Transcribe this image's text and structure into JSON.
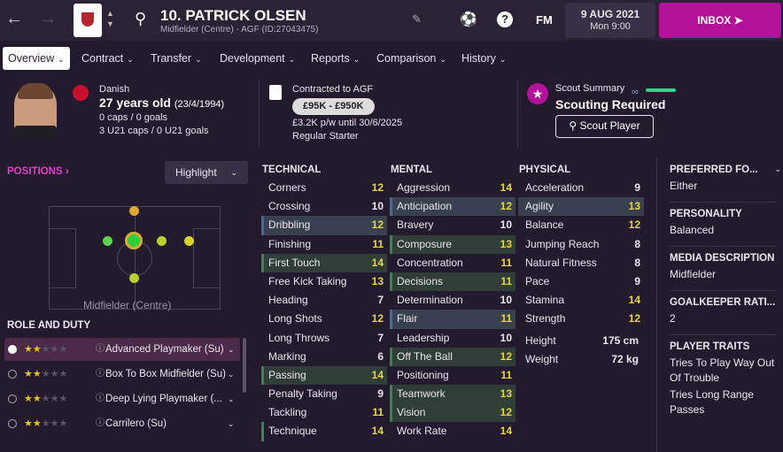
{
  "topbar": {
    "player_title": "10. PATRICK OLSEN",
    "player_sub": "Midfielder (Centre) - AGF (ID:27043475)",
    "date": "9 AUG 2021",
    "time": "Mon 9:00",
    "fm": "FM",
    "inbox": "INBOX"
  },
  "tabs": [
    {
      "label": "Overview"
    },
    {
      "label": "Contract"
    },
    {
      "label": "Transfer"
    },
    {
      "label": "Development"
    },
    {
      "label": "Reports"
    },
    {
      "label": "Comparison"
    },
    {
      "label": "History"
    }
  ],
  "profile": {
    "nationality": "Danish",
    "age": "27 years old",
    "dob": "(23/4/1994)",
    "caps": "0 caps / 0 goals",
    "u21": "3 U21 caps / 0 U21 goals"
  },
  "contract": {
    "club_label": "Contracted to AGF",
    "value": "£95K - £950K",
    "wage": "£3.2K p/w until 30/6/2025",
    "status": "Regular Starter"
  },
  "scout": {
    "label": "Scout Summary",
    "status": "Scouting Required",
    "button": "Scout Player"
  },
  "positions": {
    "title": "POSITIONS",
    "highlight": "Highlight",
    "label": "Midfielder (Centre)"
  },
  "roles": {
    "title": "ROLE AND DUTY",
    "items": [
      {
        "name": "Advanced Playmaker (Su)",
        "stars": 2
      },
      {
        "name": "Box To Box Midfielder (Su)",
        "stars": 2
      },
      {
        "name": "Deep Lying Playmaker (...",
        "stars": 2
      },
      {
        "name": "Carrilero (Su)",
        "stars": 2
      }
    ]
  },
  "technical": {
    "title": "TECHNICAL",
    "items": [
      {
        "name": "Corners",
        "value": "12"
      },
      {
        "name": "Crossing",
        "value": "10"
      },
      {
        "name": "Dribbling",
        "value": "12"
      },
      {
        "name": "Finishing",
        "value": "11"
      },
      {
        "name": "First Touch",
        "value": "14"
      },
      {
        "name": "Free Kick Taking",
        "value": "13"
      },
      {
        "name": "Heading",
        "value": "7"
      },
      {
        "name": "Long Shots",
        "value": "12"
      },
      {
        "name": "Long Throws",
        "value": "7"
      },
      {
        "name": "Marking",
        "value": "6"
      },
      {
        "name": "Passing",
        "value": "14"
      },
      {
        "name": "Penalty Taking",
        "value": "9"
      },
      {
        "name": "Tackling",
        "value": "11"
      },
      {
        "name": "Technique",
        "value": "14"
      }
    ]
  },
  "mental": {
    "title": "MENTAL",
    "items": [
      {
        "name": "Aggression",
        "value": "14"
      },
      {
        "name": "Anticipation",
        "value": "12"
      },
      {
        "name": "Bravery",
        "value": "10"
      },
      {
        "name": "Composure",
        "value": "13"
      },
      {
        "name": "Concentration",
        "value": "11"
      },
      {
        "name": "Decisions",
        "value": "11"
      },
      {
        "name": "Determination",
        "value": "10"
      },
      {
        "name": "Flair",
        "value": "11"
      },
      {
        "name": "Leadership",
        "value": "10"
      },
      {
        "name": "Off The Ball",
        "value": "12"
      },
      {
        "name": "Positioning",
        "value": "11"
      },
      {
        "name": "Teamwork",
        "value": "13"
      },
      {
        "name": "Vision",
        "value": "12"
      },
      {
        "name": "Work Rate",
        "value": "14"
      }
    ]
  },
  "physical": {
    "title": "PHYSICAL",
    "items": [
      {
        "name": "Acceleration",
        "value": "9"
      },
      {
        "name": "Agility",
        "value": "13"
      },
      {
        "name": "Balance",
        "value": "12"
      },
      {
        "name": "Jumping Reach",
        "value": "8"
      },
      {
        "name": "Natural Fitness",
        "value": "8"
      },
      {
        "name": "Pace",
        "value": "9"
      },
      {
        "name": "Stamina",
        "value": "14"
      },
      {
        "name": "Strength",
        "value": "12"
      }
    ],
    "height_label": "Height",
    "height": "175 cm",
    "weight_label": "Weight",
    "weight": "72 kg"
  },
  "side": {
    "foot_title": "PREFERRED FO...",
    "foot": "Either",
    "pers_title": "PERSONALITY",
    "pers": "Balanced",
    "media_title": "MEDIA DESCRIPTION",
    "media": "Midfielder",
    "gk_title": "GOALKEEPER RATI...",
    "gk": "2",
    "traits_title": "PLAYER TRAITS",
    "trait1": "Tries To Play Way Out Of Trouble",
    "trait2": "Tries Long Range Passes"
  }
}
